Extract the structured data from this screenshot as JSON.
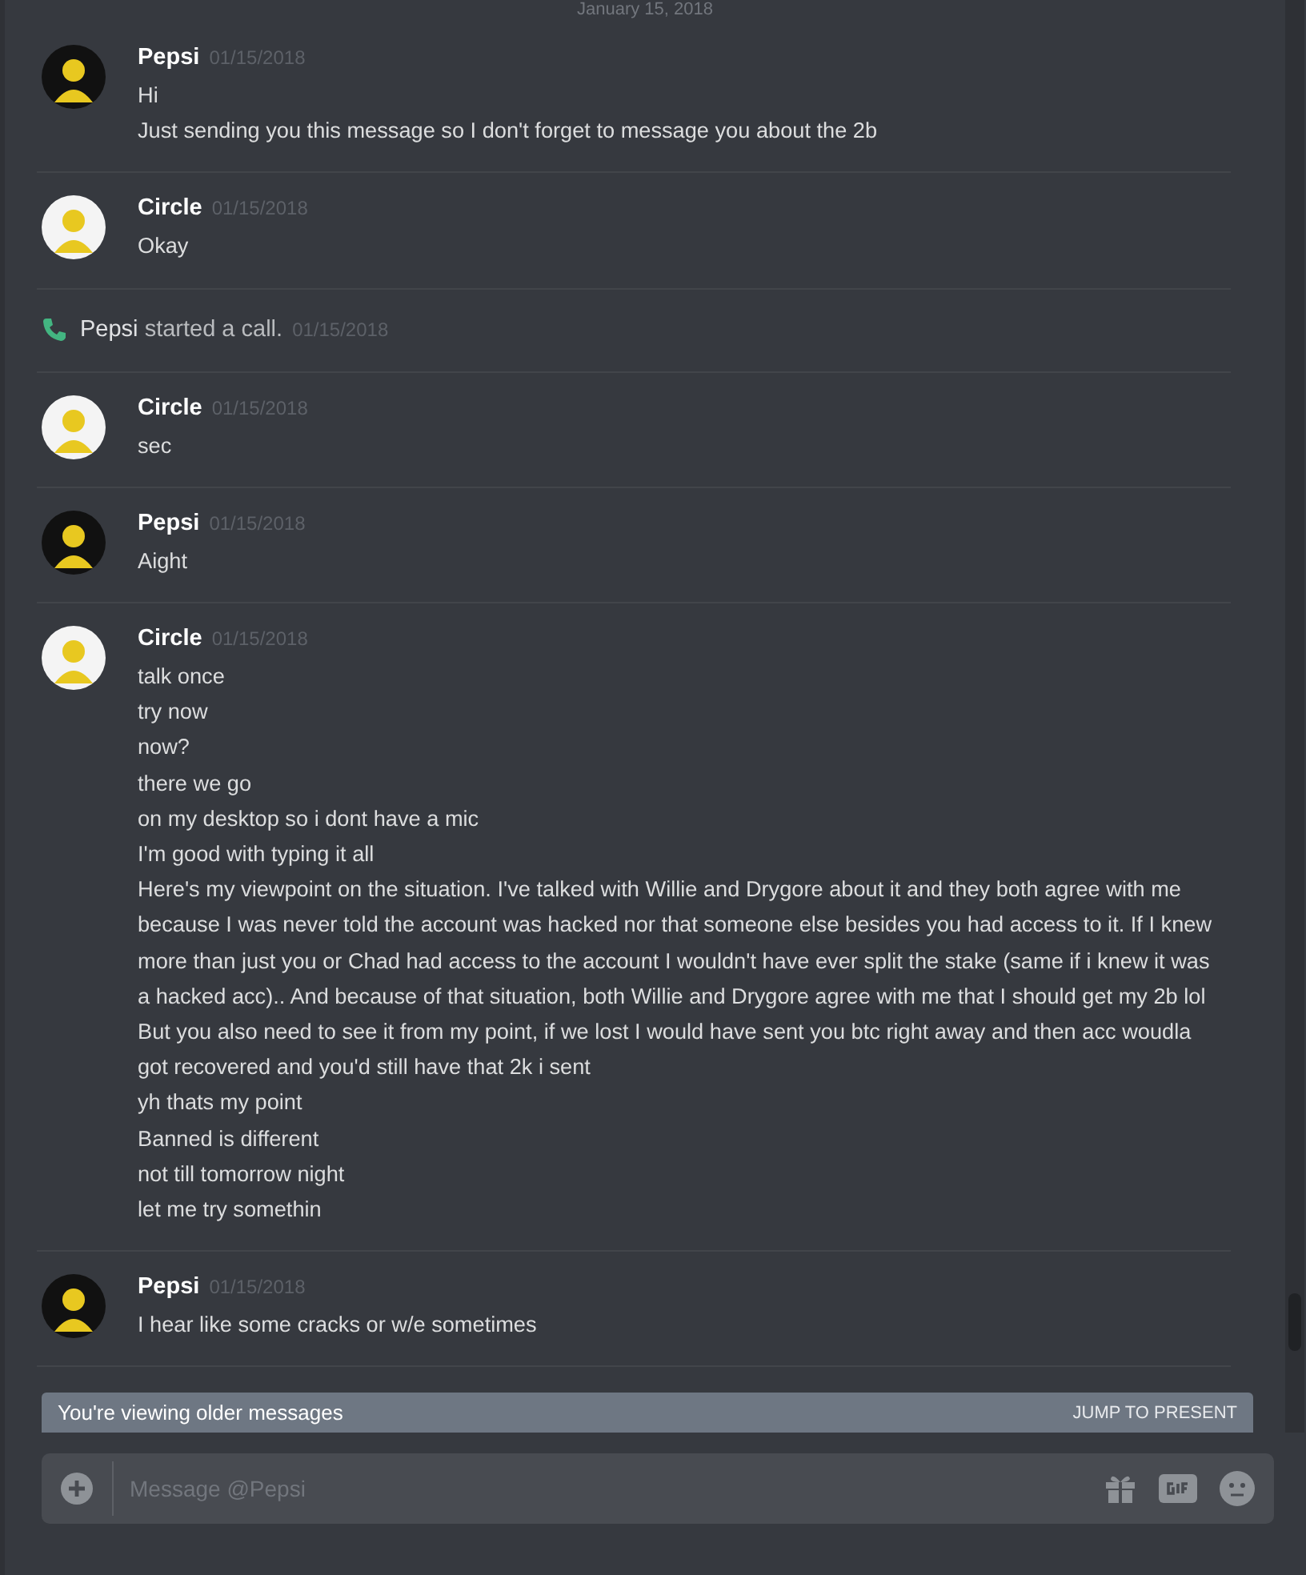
{
  "date_divider": "January 15, 2018",
  "messages": [
    {
      "kind": "message",
      "author": "Pepsi",
      "color": "#111111",
      "timestamp": "01/15/2018",
      "lines": [
        "Hi",
        "Just sending you this message so I don't forget to message you about the 2b"
      ]
    },
    {
      "kind": "message",
      "author": "Circle",
      "color": "#f4f4f4",
      "timestamp": "01/15/2018",
      "lines": [
        "Okay"
      ]
    },
    {
      "kind": "call",
      "author": "Pepsi",
      "text": "started a call.",
      "timestamp": "01/15/2018"
    },
    {
      "kind": "message",
      "author": "Circle",
      "color": "#f4f4f4",
      "timestamp": "01/15/2018",
      "lines": [
        "sec"
      ]
    },
    {
      "kind": "message",
      "author": "Pepsi",
      "color": "#111111",
      "timestamp": "01/15/2018",
      "lines": [
        "Aight"
      ]
    },
    {
      "kind": "message",
      "author": "Circle",
      "color": "#f4f4f4",
      "timestamp": "01/15/2018",
      "lines": [
        "talk once",
        "try now",
        "now?",
        "there we go",
        "on my desktop so i dont have a mic",
        "I'm good with typing it all",
        "Here's my viewpoint on the situation. I've talked with Willie and Drygore about it and they both agree with me because I was never told the account was hacked nor that someone else besides you had access to it. If I knew more than just you or Chad had access to the account I wouldn't have ever split the stake (same if i knew it was a hacked acc).. And because of that situation, both Willie and Drygore agree with me that I should get my 2b lol",
        "But you also need to see it from my point, if we lost I would have sent you btc right away and then acc woudla got recovered and you'd still have that 2k i sent",
        "yh thats my point",
        "Banned is different",
        "not till tomorrow night",
        "let me try somethin"
      ]
    },
    {
      "kind": "message",
      "author": "Pepsi",
      "color": "#111111",
      "timestamp": "01/15/2018",
      "lines": [
        "I hear like some cracks or w/e sometimes"
      ]
    }
  ],
  "banner": {
    "text": "You're viewing older messages",
    "action": "JUMP TO PRESENT"
  },
  "composer": {
    "placeholder": "Message @Pepsi"
  }
}
